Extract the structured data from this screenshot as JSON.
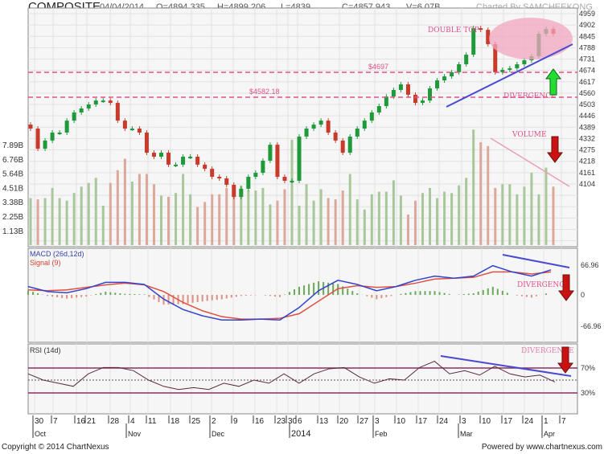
{
  "header": {
    "symbol": "COMPOSITE",
    "date": "04/04/2014",
    "open": "O=4894.335",
    "high": "H=4899.206",
    "low": "L=4839",
    "close": "C=4857.943",
    "volume": "V=6.07B",
    "credit": "Charted By SAMCHEEKONG"
  },
  "footer": {
    "copyright": "Copyright © 2014 ChartNexus",
    "powered": "Powered by www.chartnexus.com"
  },
  "colors": {
    "up": "#1f9a3a",
    "down": "#c83a2a",
    "vol_up": "#a8c79a",
    "vol_down": "#dca89a",
    "macd": "#3344cc",
    "signal": "#e05040",
    "trend": "#4a4ad0",
    "annot": "#e0508a"
  },
  "chart_data": {
    "type": "candlestick",
    "title": "COMPOSITE",
    "price_ticks": [
      "4959",
      "4902",
      "4845",
      "4788",
      "4731",
      "4674",
      "4617",
      "4560",
      "4503",
      "4446",
      "4389",
      "4332",
      "4275",
      "4218",
      "4161",
      "4104"
    ],
    "price_range": [
      4104,
      4959
    ],
    "volume_ticks": [
      "7.89B",
      "6.76B",
      "5.64B",
      "4.51B",
      "3.38B",
      "2.25B",
      "1.13B"
    ],
    "close": [
      4382,
      4281,
      4322,
      4362,
      4362,
      4422,
      4463,
      4483,
      4503,
      4523,
      4523,
      4511,
      4422,
      4382,
      4382,
      4362,
      4261,
      4241,
      4261,
      4201,
      4201,
      4241,
      4241,
      4201,
      4180,
      4140,
      4132,
      4100,
      4039,
      4080,
      4140,
      4160,
      4221,
      4301,
      4140,
      4120,
      4120,
      4342,
      4382,
      4402,
      4422,
      4362,
      4322,
      4261,
      4342,
      4382,
      4422,
      4463,
      4495,
      4543,
      4576,
      4604,
      4552,
      4511,
      4523,
      4584,
      4624,
      4644,
      4665,
      4705,
      4753,
      4886,
      4878,
      4806,
      4665,
      4677,
      4685,
      4705,
      4725,
      4745,
      4858,
      4882,
      4858
    ],
    "volume_b": [
      3.7,
      3.6,
      3.7,
      4.5,
      3.7,
      3.5,
      4.1,
      4.6,
      4.9,
      5.3,
      3.1,
      4.9,
      5.9,
      6.8,
      5.0,
      5.6,
      5.6,
      4.8,
      3.9,
      3.8,
      4.1,
      5.6,
      4.0,
      3.0,
      3.4,
      4.0,
      4.0,
      4.5,
      4.5,
      4.7,
      4.3,
      4.3,
      4.5,
      3.2,
      3.5,
      4.4,
      8.3,
      3.1,
      4.8,
      3.5,
      4.4,
      3.7,
      3.6,
      4.3,
      5.6,
      3.6,
      2.8,
      4.0,
      4.2,
      4.2,
      5.1,
      3.9,
      2.4,
      3.5,
      4.1,
      4.5,
      3.7,
      4.2,
      4.1,
      4.7,
      5.3,
      9.1,
      8.1,
      7.8,
      4.5,
      4.8,
      4.8,
      4.0,
      4.6,
      5.7,
      4.0,
      6.1,
      4.6
    ],
    "macd_label": "MACD (26d,12d)",
    "signal_label": "Signal (9)",
    "macd_ticks": [
      "66.96",
      "0",
      "-66.96"
    ],
    "macd": [
      20,
      8,
      5,
      15,
      30,
      30,
      25,
      -10,
      -35,
      -50,
      -60,
      -60,
      -58,
      -60,
      -30,
      10,
      35,
      25,
      10,
      20,
      35,
      45,
      40,
      45,
      70,
      55,
      45,
      60
    ],
    "signal": [
      12,
      10,
      12,
      18,
      24,
      28,
      24,
      8,
      -18,
      -38,
      -52,
      -58,
      -58,
      -56,
      -45,
      -15,
      15,
      22,
      18,
      20,
      28,
      38,
      40,
      42,
      55,
      55,
      50,
      55
    ],
    "rsi_label": "RSI (14d)",
    "rsi_ticks": [
      "70%",
      "30%"
    ],
    "rsi": [
      60,
      50,
      45,
      40,
      60,
      70,
      70,
      65,
      50,
      40,
      35,
      38,
      35,
      45,
      40,
      50,
      45,
      60,
      45,
      60,
      68,
      70,
      55,
      45,
      52,
      50,
      70,
      80,
      60,
      65,
      58,
      72,
      60,
      55,
      58,
      47
    ],
    "date_ticks": [
      "30",
      "7",
      "16",
      "21",
      "28",
      "4",
      "11",
      "18",
      "25",
      "2",
      "9",
      "16",
      "23",
      "30",
      "6",
      "13",
      "20",
      "27",
      "3",
      "10",
      "17",
      "24",
      "3",
      "10",
      "17",
      "24",
      "1",
      "7"
    ],
    "month_labels": [
      "Oct",
      "Nov",
      "Dec",
      "2014",
      "Feb",
      "Mar",
      "Apr"
    ],
    "annotations": {
      "double_top": "DOUBLE TOP",
      "level1": "$4697",
      "level2": "$4582.18",
      "divergence": "DIVERGENCE",
      "volume": "VOLUME"
    }
  }
}
